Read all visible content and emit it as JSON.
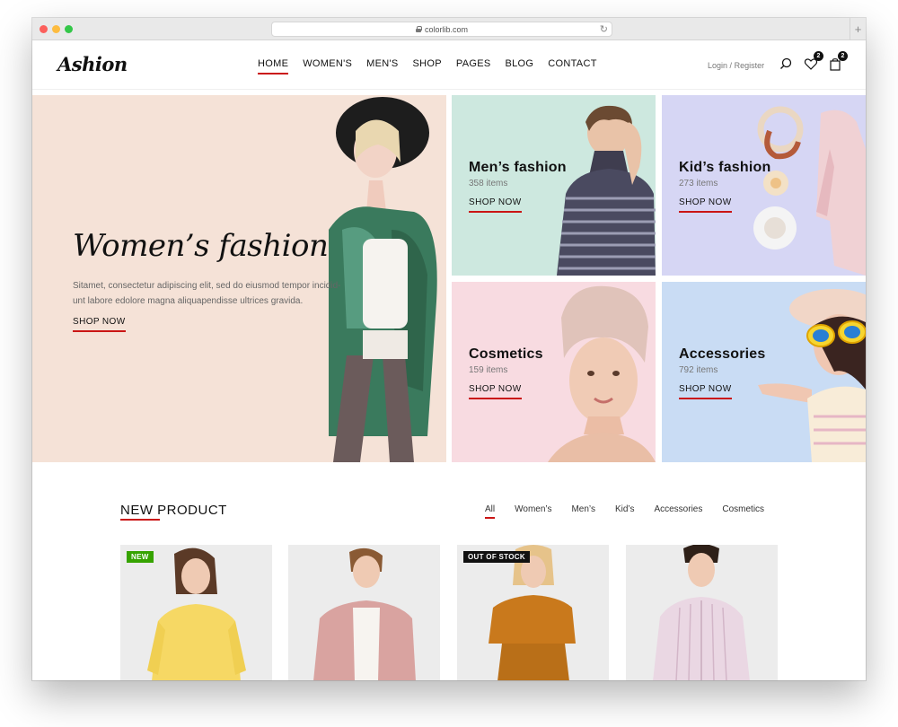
{
  "browser": {
    "url": "colorlib.com"
  },
  "header": {
    "logo": "Ashion",
    "nav": [
      "HOME",
      "WOMEN'S",
      "MEN'S",
      "SHOP",
      "PAGES",
      "BLOG",
      "CONTACT"
    ],
    "active_nav": "HOME",
    "login": "Login",
    "separator": "/",
    "register": "Register",
    "wishlist_count": "2",
    "cart_count": "2"
  },
  "hero": {
    "title": "Women’s fashion",
    "text": "Sitamet, consectetur adipiscing elit, sed do eiusmod tempor incidid-unt labore edolore magna aliquapendisse ultrices gravida.",
    "cta": "SHOP NOW"
  },
  "categories": [
    {
      "title": "Men’s fashion",
      "count": "358 items",
      "cta": "SHOP NOW"
    },
    {
      "title": "Kid’s fashion",
      "count": "273 items",
      "cta": "SHOP NOW"
    },
    {
      "title": "Cosmetics",
      "count": "159 items",
      "cta": "SHOP NOW"
    },
    {
      "title": "Accessories",
      "count": "792 items",
      "cta": "SHOP NOW"
    }
  ],
  "products_section": {
    "title": "NEW PRODUCT",
    "filters": [
      "All",
      "Women’s",
      "Men’s",
      "Kid’s",
      "Accessories",
      "Cosmetics"
    ],
    "active_filter": "All",
    "products": [
      {
        "label": "NEW",
        "garment_color": "#f6d864"
      },
      {
        "label": "",
        "garment_color": "#d9a3a0"
      },
      {
        "label": "OUT OF STOCK",
        "garment_color": "#c9791c"
      },
      {
        "label": "",
        "garment_color": "#ead7e3"
      }
    ]
  },
  "colors": {
    "accent": "#ca1515",
    "hero_bg": "#f5e2d7",
    "men_bg": "#cde8df",
    "kid_bg": "#d6d6f4",
    "cosmetics_bg": "#f8dbe1",
    "accessories_bg": "#c9dcf4"
  }
}
